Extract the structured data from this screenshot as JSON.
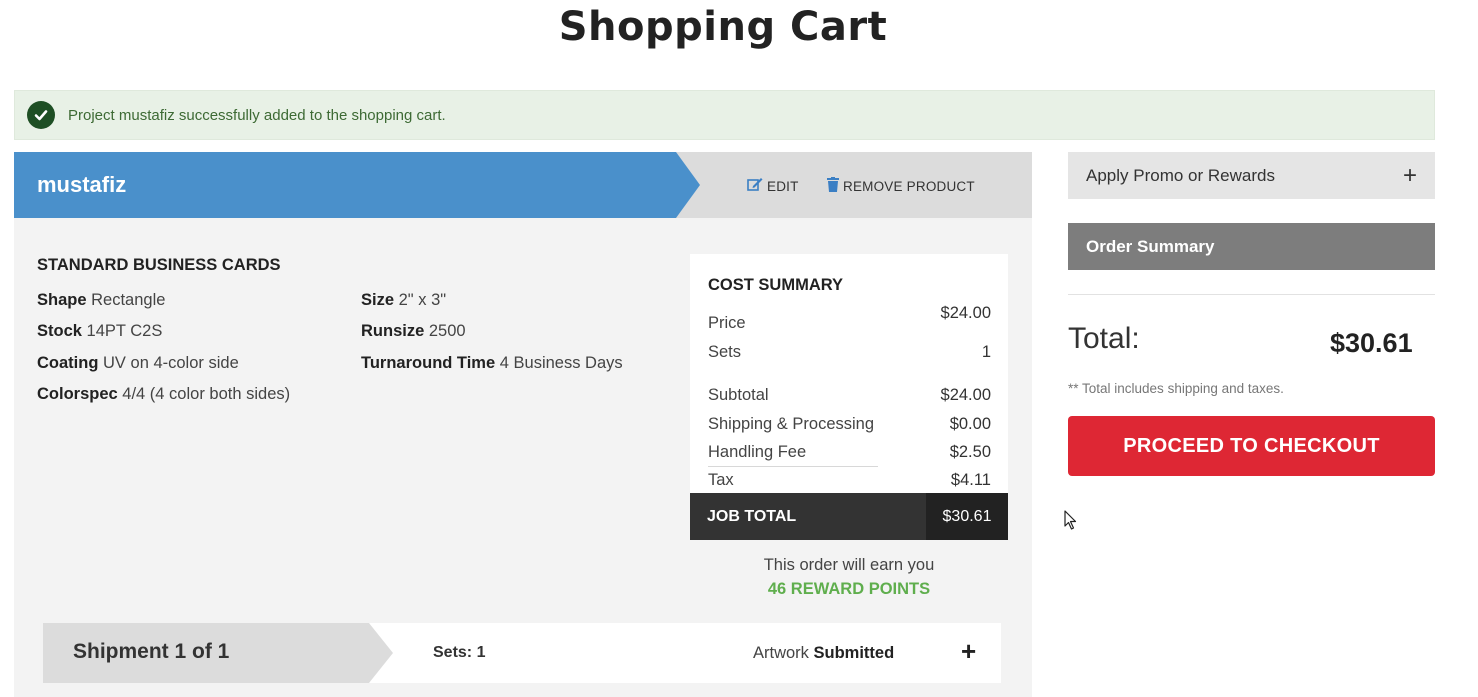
{
  "page": {
    "title": "Shopping Cart"
  },
  "alert": {
    "message": "Project mustafiz successfully added to the shopping cart."
  },
  "product": {
    "name": "mustafiz",
    "edit_label": "EDIT",
    "remove_label": "REMOVE PRODUCT",
    "type": "STANDARD BUSINESS CARDS",
    "specs": [
      {
        "label": "Shape",
        "value": "Rectangle"
      },
      {
        "label": "Stock",
        "value": "14PT C2S"
      },
      {
        "label": "Coating",
        "value": "UV on 4-color side"
      },
      {
        "label": "Colorspec",
        "value": "4/4 (4 color both sides)"
      },
      {
        "label": "Size",
        "value": "2\" x 3\""
      },
      {
        "label": "Runsize",
        "value": "2500"
      },
      {
        "label": "Turnaround Time",
        "value": "4 Business Days"
      }
    ]
  },
  "cost_summary": {
    "title": "COST SUMMARY",
    "rows": [
      {
        "label": "Price",
        "value": "$24.00"
      },
      {
        "label": "Sets",
        "value": "1"
      },
      {
        "label": "Subtotal",
        "value": "$24.00"
      },
      {
        "label": "Shipping & Processing",
        "value": "$0.00"
      },
      {
        "label": "Handling Fee",
        "value": "$2.50"
      },
      {
        "label": "Tax",
        "value": "$4.11"
      }
    ],
    "job_total_label": "JOB TOTAL",
    "job_total_value": "$30.61"
  },
  "rewards": {
    "text": "This order will earn you",
    "points": "46 REWARD POINTS"
  },
  "shipment": {
    "label": "Shipment 1 of 1",
    "sets": "Sets: 1",
    "artwork_label": "Artwork",
    "artwork_status": "Submitted",
    "expand": "+"
  },
  "sidebar": {
    "promo_label": "Apply Promo or Rewards",
    "promo_toggle": "+",
    "order_summary_label": "Order Summary",
    "total_label": "Total:",
    "total_value": "$30.61",
    "total_note": "** Total includes shipping and taxes.",
    "checkout_label": "PROCEED TO CHECKOUT"
  },
  "colors": {
    "accent_blue": "#4a90cb",
    "checkout_red": "#de2734",
    "success_green": "#5fae4d",
    "alert_bg": "#e8f1e6"
  },
  "icons": [
    "check-circle-icon",
    "edit-icon",
    "trash-icon",
    "plus-icon",
    "mouse-cursor-icon"
  ]
}
